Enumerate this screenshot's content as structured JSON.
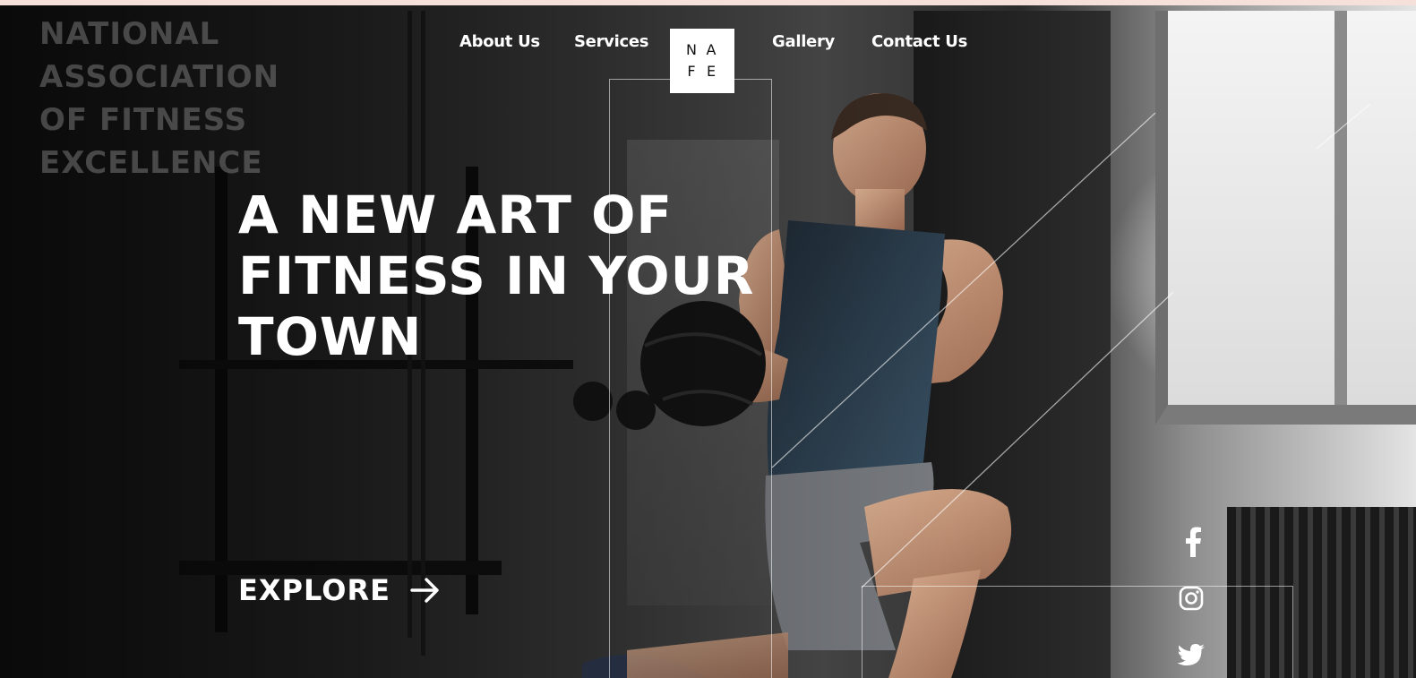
{
  "brand": {
    "name": "NATIONAL\nASSOCIATION\nOF FITNESS\nEXCELLENCE",
    "logo_letters": [
      "N",
      "A",
      "F",
      "E"
    ]
  },
  "nav": {
    "items": [
      {
        "label": "About Us"
      },
      {
        "label": "Services"
      },
      {
        "label": "Gallery"
      },
      {
        "label": "Contact Us"
      }
    ]
  },
  "hero": {
    "headline_lines": [
      "A NEW ART OF",
      "FITNESS IN YOUR",
      "TOWN"
    ],
    "cta_label": "EXPLORE"
  },
  "social": {
    "icons": [
      "facebook-icon",
      "instagram-icon",
      "twitter-icon"
    ]
  },
  "colors": {
    "text": "#ffffff",
    "brand_muted": "#7a7a7a",
    "top_band": "#f6e0da",
    "logo_bg": "#ffffff"
  }
}
